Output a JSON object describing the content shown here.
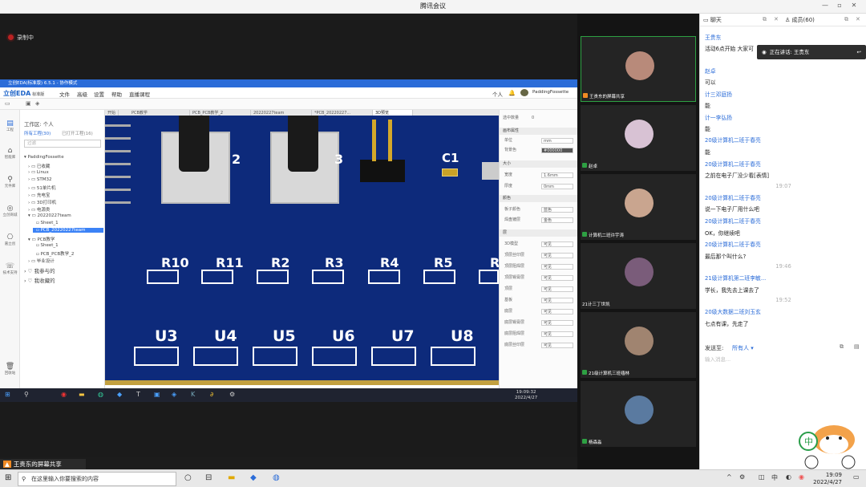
{
  "window": {
    "title": "腾讯会议"
  },
  "recording": {
    "label": "录制中"
  },
  "eda": {
    "title": "立创EDA(标准版) 6.5.1 - 协作模式",
    "logo": "立创EDA",
    "logo_sub": "标准版",
    "menu": [
      "文件",
      "高级",
      "设置",
      "帮助",
      "直播课程"
    ],
    "user_menu": "个人",
    "user": "PaddingFossette",
    "leftbar": [
      "工程",
      "智能库",
      "元件库",
      "立创商城",
      "嘉立创",
      "技术支持",
      "回收站"
    ],
    "tree": {
      "workspace": "工作区: 个人",
      "tab_all": "所有工程(30)",
      "tab_joined": "已打开工程(16)",
      "filter_placeholder": "过滤",
      "items": [
        "PaddingFossette",
        "已收藏",
        "Linux",
        "STM32",
        "51单片机",
        "充电宝",
        "3D打印机",
        "电源类",
        "20220227team",
        "Sheet_1",
        "PCB_20220227team",
        "PCB教学",
        "Sheet_1",
        "PCB_PCB教学_2",
        "毕业设计",
        "我参与的",
        "我收藏的"
      ]
    },
    "tabs": [
      "开始",
      "PCB教学",
      "PCB_PCB教学_2",
      "20220227team",
      "*PCB_20220227...",
      "3D预览"
    ],
    "props": {
      "count_label": "选中数量",
      "count_value": "0",
      "sec_canvas": "画布属性",
      "unit_k": "单位",
      "unit_v": "mm",
      "bg_k": "背景色",
      "bg_v": "#000000",
      "sec_size": "大小",
      "w_k": "宽度",
      "w_v": "1.6mm",
      "h_k": "厚度",
      "h_v": "0mm",
      "sec_color": "颜色",
      "board_k": "板子颜色",
      "board_v": "蓝色",
      "finish_k": "焊盘镀层",
      "finish_v": "金色",
      "sec_layer": "层",
      "layers": [
        [
          "3D模型",
          "可见"
        ],
        [
          "顶层丝印层",
          "可见"
        ],
        [
          "顶层阻焊层",
          "可见"
        ],
        [
          "顶层锡膏层",
          "可见"
        ],
        [
          "顶层",
          "可见"
        ],
        [
          "基板",
          "可见"
        ],
        [
          "底层",
          "可见"
        ],
        [
          "底层锡膏层",
          "可见"
        ],
        [
          "底层阻焊层",
          "可见"
        ],
        [
          "底层丝印层",
          "可见"
        ]
      ]
    },
    "pcb": {
      "top_labels": [
        "2",
        "3",
        "C1"
      ],
      "resistors": [
        "R10",
        "R11",
        "R2",
        "R3",
        "R4",
        "R5",
        "R"
      ],
      "chips": [
        "U3",
        "U4",
        "U5",
        "U6",
        "U7",
        "U8"
      ]
    },
    "inner_clock": {
      "time": "19:09:32",
      "date": "2022/4/27"
    }
  },
  "share_label": "王贵东的屏幕共享",
  "videos": [
    {
      "name": "王贵东的屏幕共享",
      "active": true,
      "avatar_color": "#b88a7a"
    },
    {
      "name": "赵卓",
      "active": false,
      "avatar_color": "#d8c2d4"
    },
    {
      "name": "计算机二班许宇涛",
      "active": false,
      "avatar_color": "#c9a58f"
    },
    {
      "name": "21计三丁世凯",
      "active": false,
      "avatar_color": "#7a5c7a"
    },
    {
      "name": "21级计算机三班缅林",
      "active": false,
      "avatar_color": "#a08470"
    },
    {
      "name": "杨森淼",
      "active": false,
      "avatar_color": "#5a7aa0"
    }
  ],
  "chat": {
    "tab_chat": "聊天",
    "tab_members": "成员(60)",
    "speaking": "正在讲话: 王贵东",
    "messages": [
      {
        "name": "王贵东",
        "text": "活动6点开始 大家可"
      },
      {
        "name": "赵卓",
        "text": "可以"
      },
      {
        "name": "计三邓庭扬",
        "text": "能"
      },
      {
        "name": "计一李弘扬",
        "text": "能"
      },
      {
        "name": "20级计算机二班于春亮",
        "text": "能"
      },
      {
        "name": "20级计算机二班于春亮",
        "text": "之前在电子厂没少看[表情]"
      },
      {
        "time": "19:07"
      },
      {
        "name": "20级计算机二班于春亮",
        "text": "说一下电子厂用什么吧"
      },
      {
        "name": "20级计算机二班于春亮",
        "text": "OK，你继续吧"
      },
      {
        "name": "20级计算机二班于春亮",
        "text": "最后那个叫什么?"
      },
      {
        "time": "19:46"
      },
      {
        "name": "21级计算机第二班李敏...",
        "text": "学长，我先去上课去了"
      },
      {
        "time": "19:52"
      },
      {
        "name": "20级大数据二班刘玉玄",
        "text": "七点有课，先走了"
      }
    ],
    "send_to_label": "发送至:",
    "send_to_value": "所有人",
    "input_placeholder": "输入消息..."
  },
  "taskbar": {
    "search_placeholder": "在这里输入你要搜索的内容",
    "time": "19:09",
    "date": "2022/4/27",
    "lang": "中"
  }
}
